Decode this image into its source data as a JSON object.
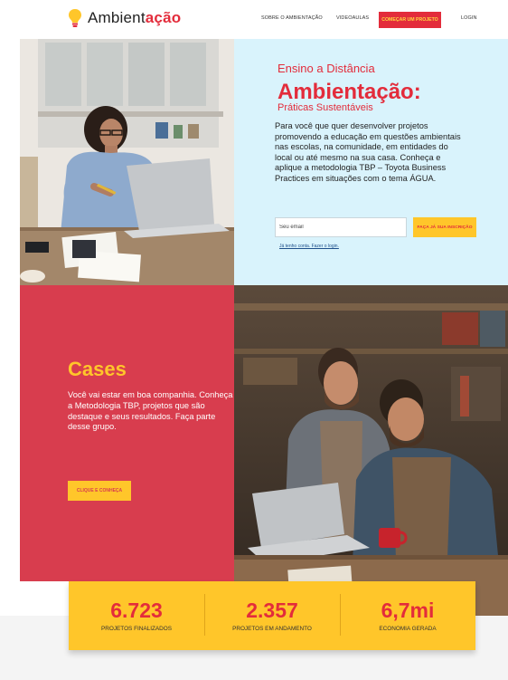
{
  "brand": {
    "logo_plain": "Ambient",
    "logo_accent": "ação",
    "accent_color": "#e32c3b",
    "yellow": "#ffc62a",
    "light_blue": "#d9f3fc"
  },
  "nav": {
    "links": [
      "SOBRE O AMBIENTAÇÃO",
      "VIDEOAULAS"
    ],
    "cta": "COMEÇAR UM PROJETO",
    "login": "LOGIN"
  },
  "hero": {
    "kicker": "Ensino a Distância",
    "title": "Ambientação:",
    "subtitle": "Práticas Sustentáveis",
    "body": "Para você que quer desenvolver projetos promovendo a educação em questões ambientais nas escolas, na comunidade, em entidades do local ou até mesmo na sua casa. Conheça e aplique a metodologia TBP – Toyota Business Practices em situações com o tema ÁGUA.",
    "email_placeholder": "Seu email",
    "signup_button": "FAÇA JÁ SUA INSCRIÇÃO",
    "login_link": "Já tenho conta. Fazer o login."
  },
  "cases": {
    "title": "Cases",
    "body": "Você vai estar em boa companhia. Conheça a Metodologia TBP, projetos que são destaque e seus resultados. Faça parte desse grupo.",
    "button": "CLIQUE E CONHEÇA"
  },
  "stats": [
    {
      "value": "6.723",
      "label": "PROJETOS FINALIZADOS"
    },
    {
      "value": "2.357",
      "label": "PROJETOS EM ANDAMENTO"
    },
    {
      "value": "6,7mi",
      "label": "ECONOMIA GERADA"
    }
  ]
}
